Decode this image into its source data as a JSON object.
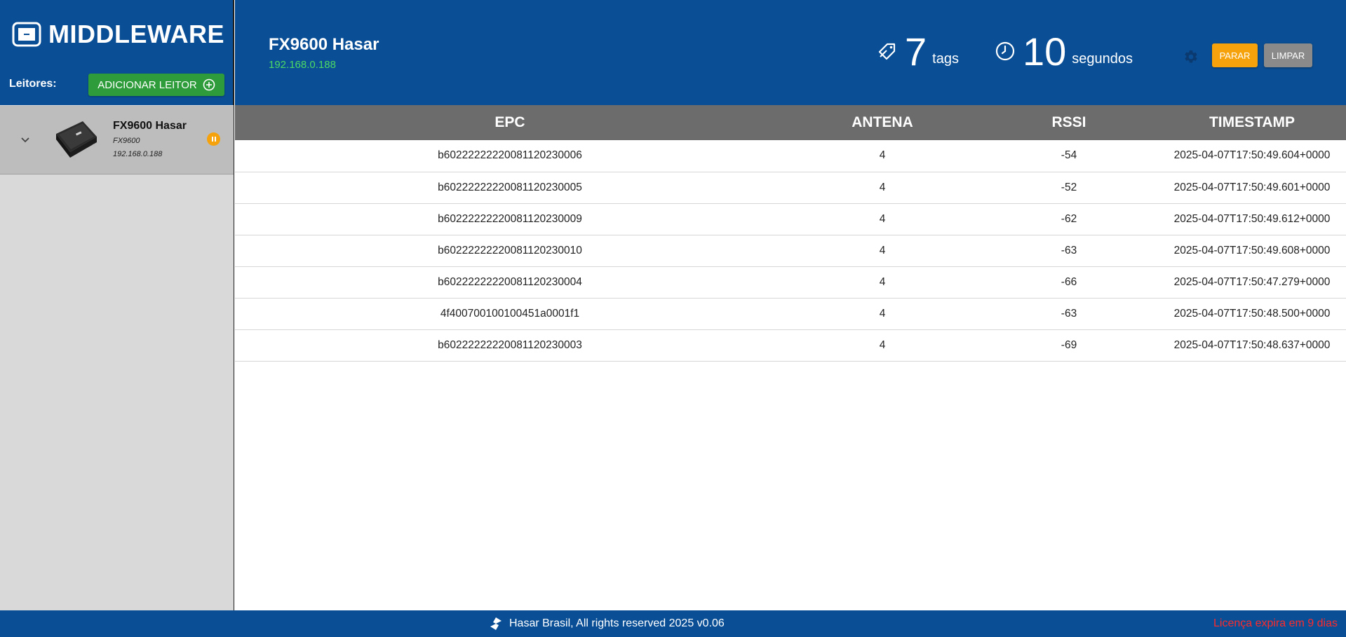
{
  "sidebar": {
    "brand": "MIDDLEWARE",
    "readers_label": "Leitores:",
    "add_button": "ADICIONAR LEITOR",
    "reader": {
      "name": "FX9600 Hasar",
      "model": "FX9600",
      "ip": "192.168.0.188",
      "status": "paused"
    }
  },
  "header": {
    "title": "FX9600 Hasar",
    "ip": "192.168.0.188",
    "tags_count": "7",
    "tags_unit": "tags",
    "seconds_count": "10",
    "seconds_unit": "segundos",
    "stop_button": "PARAR",
    "clear_button": "LIMPAR"
  },
  "table": {
    "columns": [
      "EPC",
      "ANTENA",
      "RSSI",
      "TIMESTAMP"
    ],
    "rows": [
      {
        "epc": "b60222222220081120230006",
        "antenna": "4",
        "rssi": "-54",
        "timestamp": "2025-04-07T17:50:49.604+0000"
      },
      {
        "epc": "b60222222220081120230005",
        "antenna": "4",
        "rssi": "-52",
        "timestamp": "2025-04-07T17:50:49.601+0000"
      },
      {
        "epc": "b60222222220081120230009",
        "antenna": "4",
        "rssi": "-62",
        "timestamp": "2025-04-07T17:50:49.612+0000"
      },
      {
        "epc": "b60222222220081120230010",
        "antenna": "4",
        "rssi": "-63",
        "timestamp": "2025-04-07T17:50:49.608+0000"
      },
      {
        "epc": "b60222222220081120230004",
        "antenna": "4",
        "rssi": "-66",
        "timestamp": "2025-04-07T17:50:47.279+0000"
      },
      {
        "epc": "4f400700100100451a0001f1",
        "antenna": "4",
        "rssi": "-63",
        "timestamp": "2025-04-07T17:50:48.500+0000"
      },
      {
        "epc": "b60222222220081120230003",
        "antenna": "4",
        "rssi": "-69",
        "timestamp": "2025-04-07T17:50:48.637+0000"
      }
    ]
  },
  "footer": {
    "copyright": "Hasar Brasil, All rights reserved 2025 v0.06",
    "license": "Licença expira em 9 dias"
  },
  "colors": {
    "primary": "#0a4f96",
    "success": "#2e9c3a",
    "warning": "#f5a20c",
    "ip_green": "#4cd964",
    "license_red": "#ff2a2a"
  },
  "icons": [
    "brand-logo-icon",
    "add-circle-icon",
    "chevron-down-icon",
    "reader-device-image",
    "pause-icon",
    "tag-icon",
    "clock-icon",
    "gear-icon",
    "hasar-logo-icon"
  ]
}
